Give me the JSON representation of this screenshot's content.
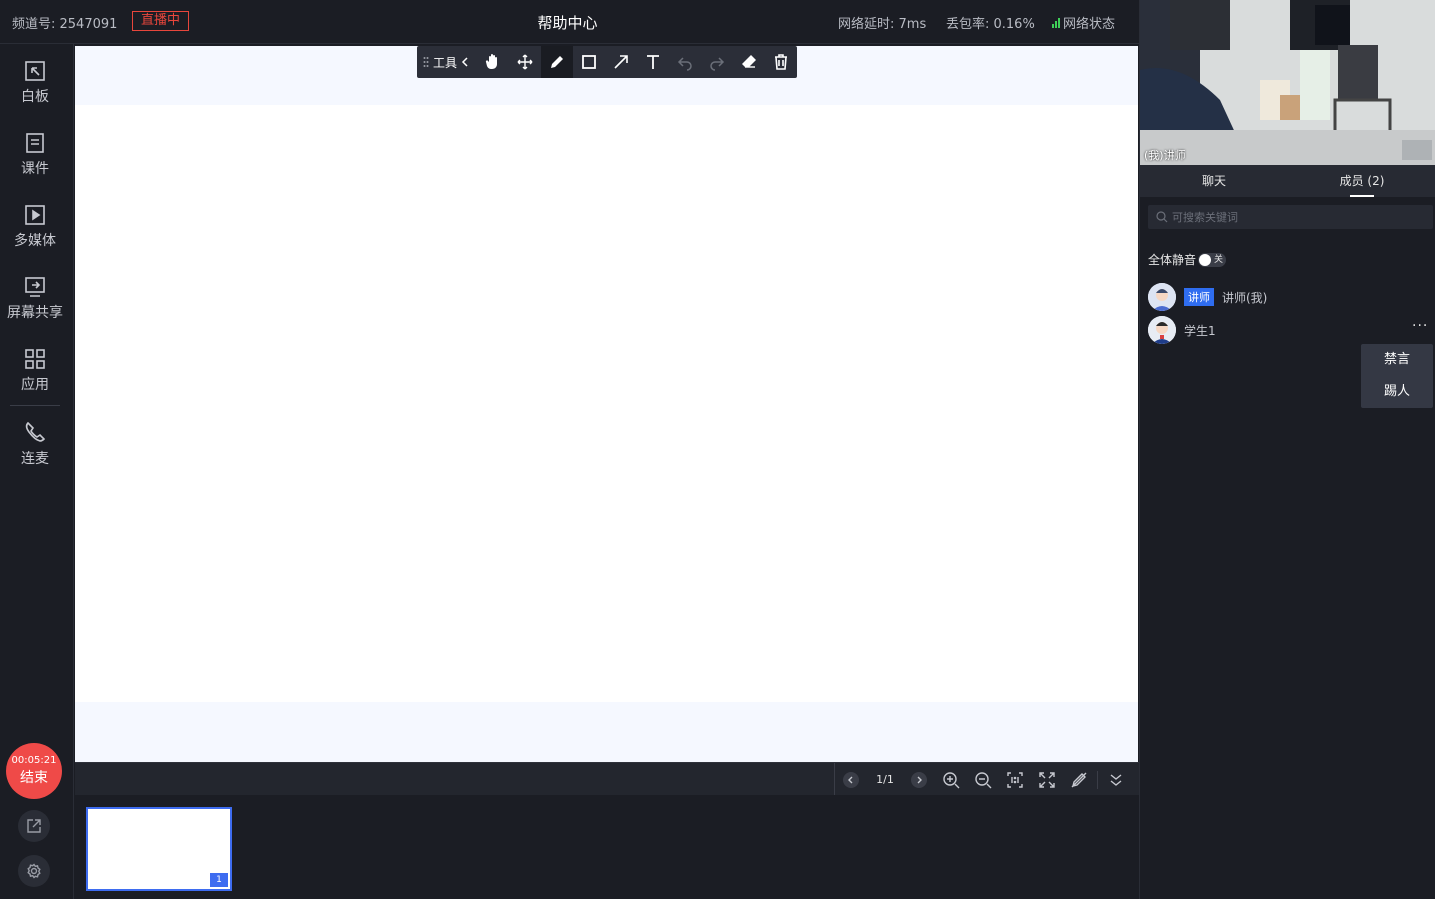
{
  "topbar": {
    "channel": "频道号: 2547091",
    "live_badge": "直播中",
    "title": "帮助中心",
    "latency": "网络延时: 7ms",
    "packet_loss": "丢包率: 0.16%",
    "network_status": "网络状态",
    "status_color": "#3fcf58",
    "live_color": "#e8463c"
  },
  "leftnav": {
    "items": [
      {
        "label": "白板",
        "icon": "whiteboard-icon"
      },
      {
        "label": "课件",
        "icon": "courseware-icon"
      },
      {
        "label": "多媒体",
        "icon": "multimedia-icon"
      },
      {
        "label": "屏幕共享",
        "icon": "screen-share-icon"
      },
      {
        "label": "应用",
        "icon": "apps-icon"
      },
      {
        "label": "连麦",
        "icon": "phone-icon"
      }
    ],
    "end_time": "00:05:21",
    "end_label": "结束",
    "end_color": "#ef4a48"
  },
  "toolbar": {
    "label": "工具",
    "tools": [
      "hand-icon",
      "move-icon",
      "pen-icon",
      "rect-icon",
      "arrow-icon",
      "text-icon",
      "undo-icon",
      "redo-icon",
      "eraser-icon",
      "trash-icon"
    ],
    "active_tool": "pen-icon"
  },
  "pager": {
    "page": "1/1",
    "controls": [
      "zoom-in-icon",
      "zoom-out-icon",
      "actual-size-icon",
      "fullscreen-icon",
      "annotation-off-icon",
      "collapse-icon"
    ]
  },
  "thumbnails": [
    {
      "number": "1",
      "selected": true
    }
  ],
  "rightpanel": {
    "video_label": "(我)讲师",
    "tabs": [
      {
        "label": "聊天",
        "active": false
      },
      {
        "label": "成员 (2)",
        "active": true
      }
    ],
    "search_placeholder": "可搜索关键词",
    "mute_all_label": "全体静音",
    "mute_state": "关",
    "members": [
      {
        "role": "讲师",
        "name": "讲师(我)"
      },
      {
        "role": "",
        "name": "学生1"
      }
    ],
    "more_label": "···",
    "menu": [
      "禁言",
      "踢人"
    ],
    "accent": "#2f6df0"
  }
}
